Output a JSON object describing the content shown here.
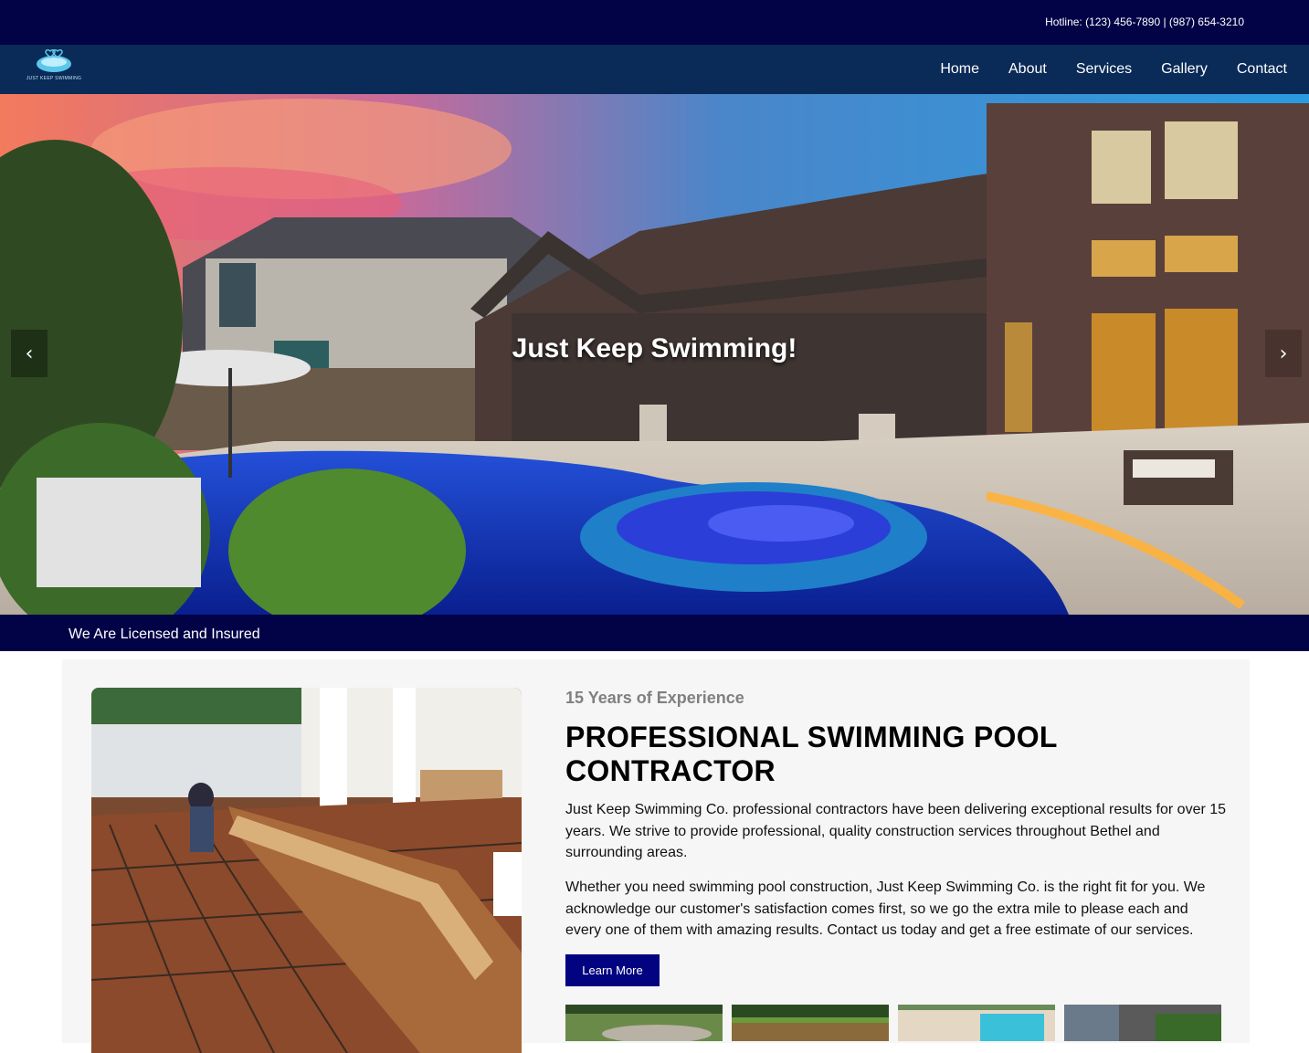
{
  "header": {
    "hotline": "Hotline: (123) 456-7890 | (987) 654-3210"
  },
  "brand": {
    "logo_text": "JUST KEEP SWIMMING",
    "logo_icon": "pool-heart-logo-icon"
  },
  "nav": {
    "items": [
      {
        "label": "Home"
      },
      {
        "label": "About"
      },
      {
        "label": "Services"
      },
      {
        "label": "Gallery"
      },
      {
        "label": "Contact"
      }
    ]
  },
  "hero": {
    "title": "Just Keep Swimming!",
    "prev_icon": "chevron-left-icon",
    "next_icon": "chevron-right-icon",
    "prev_glyph": "‹",
    "next_glyph": "›"
  },
  "license": {
    "text": "We Are Licensed and Insured"
  },
  "about": {
    "kicker": "15 Years of Experience",
    "headline": "PROFESSIONAL SWIMMING POOL CONTRACTOR",
    "paragraph1": "Just Keep Swimming Co. professional contractors have been delivering exceptional results for over 15 years. We strive to provide professional, quality construction services throughout Bethel and surrounding areas.",
    "paragraph2": "Whether you need swimming pool construction, Just Keep Swimming Co. is the right fit for you. We acknowledge our customer's satisfaction comes first, so we go the extra mile to please each and every one of them with amazing results. Contact us today and get a free estimate of our services.",
    "button": "Learn More"
  },
  "colors": {
    "topbar": "#020347",
    "navbar": "#0a2a57",
    "button": "#020380",
    "content_bg": "#f6f6f6"
  }
}
